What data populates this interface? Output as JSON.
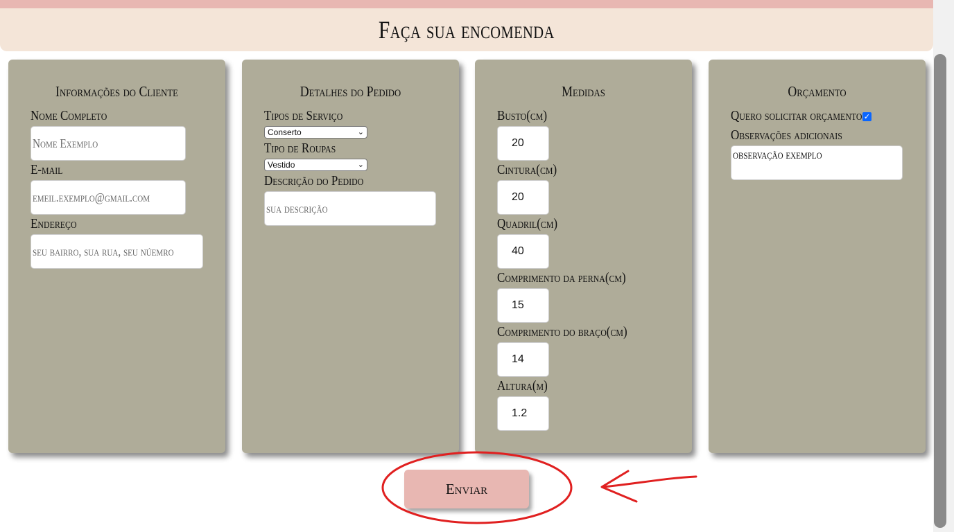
{
  "page_title": "Faça sua encomenda",
  "colors": {
    "header_strip": "#e8b7b2",
    "header_bg": "#f4e5d8",
    "panel_bg": "#afac99",
    "submit_bg": "#e8b7b2",
    "annotation": "#e02020",
    "checkbox": "#0a66ff"
  },
  "cliente": {
    "title": "Informações do Cliente",
    "nome_label": "Nome Completo",
    "nome_placeholder": "Nome Exemplo",
    "email_label": "E-mail",
    "email_placeholder": "emeil.exemplo@gmail.com",
    "endereco_label": "Endereço",
    "endereco_placeholder": "seu bairro, sua rua, seu núemro"
  },
  "pedido": {
    "title": "Detalhes do Pedido",
    "servico_label": "Tipos de Serviço",
    "servico_value": "Conserto",
    "roupas_label": "Tipo de Roupas",
    "roupas_value": "Vestido",
    "descricao_label": "Descrição do Pedido",
    "descricao_placeholder": "sua descrição"
  },
  "medidas": {
    "title": "Medidas",
    "fields": [
      {
        "label": "Busto(cm)",
        "value": "20"
      },
      {
        "label": "Cintura(cm)",
        "value": "20"
      },
      {
        "label": "Quadril(cm)",
        "value": "40"
      },
      {
        "label": "Comprimento da perna(cm)",
        "value": "15"
      },
      {
        "label": "Comprimento do braço(cm)",
        "value": "14"
      },
      {
        "label": "Altura(m)",
        "value": "1.2"
      }
    ]
  },
  "orcamento": {
    "title": "Orçamento",
    "checkbox_label": "Quero solicitar orçamento",
    "checkbox_checked": true,
    "obs_label": "Observações adicionais",
    "obs_value": "observação exemplo"
  },
  "submit_label": "Enviar"
}
